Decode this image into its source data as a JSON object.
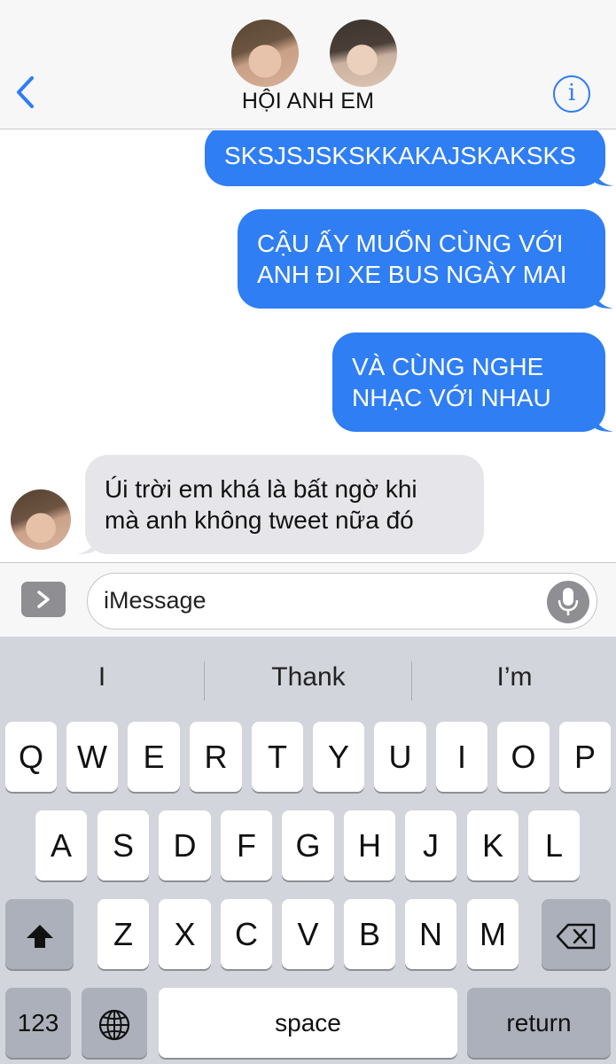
{
  "header": {
    "group_name": "HỘI ANH EM",
    "back_icon": "chevron-left-icon",
    "info_icon": "info-icon",
    "info_glyph": "i",
    "accent_color": "#2f7cf6"
  },
  "messages": [
    {
      "sender": "me",
      "lines": [
        "SKSJSJSKSKKAKAJSKAKSKS"
      ]
    },
    {
      "sender": "me",
      "lines": [
        "CẬU ẤY MUỐN CÙNG VỚI",
        "ANH ĐI XE BUS NGÀY MAI"
      ]
    },
    {
      "sender": "me",
      "lines": [
        "VÀ CÙNG NGHE",
        "NHẠC VỚI NHAU"
      ]
    },
    {
      "sender": "other",
      "lines": [
        "Úi trời em khá là bất ngờ khi",
        "mà anh không tweet nữa đó"
      ]
    }
  ],
  "colors": {
    "sent_bubble": "#2f7ef3",
    "received_bubble": "#e5e5ea"
  },
  "input": {
    "placeholder": "iMessage",
    "apps_icon": "chevron-right-icon",
    "mic_icon": "microphone-icon"
  },
  "keyboard": {
    "suggestions": [
      "I",
      "Thank",
      "I’m"
    ],
    "row1": [
      "Q",
      "W",
      "E",
      "R",
      "T",
      "Y",
      "U",
      "I",
      "O",
      "P"
    ],
    "row2": [
      "A",
      "S",
      "D",
      "F",
      "G",
      "H",
      "J",
      "K",
      "L"
    ],
    "row3": [
      "Z",
      "X",
      "C",
      "V",
      "B",
      "N",
      "M"
    ],
    "shift_icon": "shift-arrow-icon",
    "delete_icon": "backspace-icon",
    "globe_icon": "globe-icon",
    "numbers_label": "123",
    "space_label": "space",
    "return_label": "return"
  }
}
